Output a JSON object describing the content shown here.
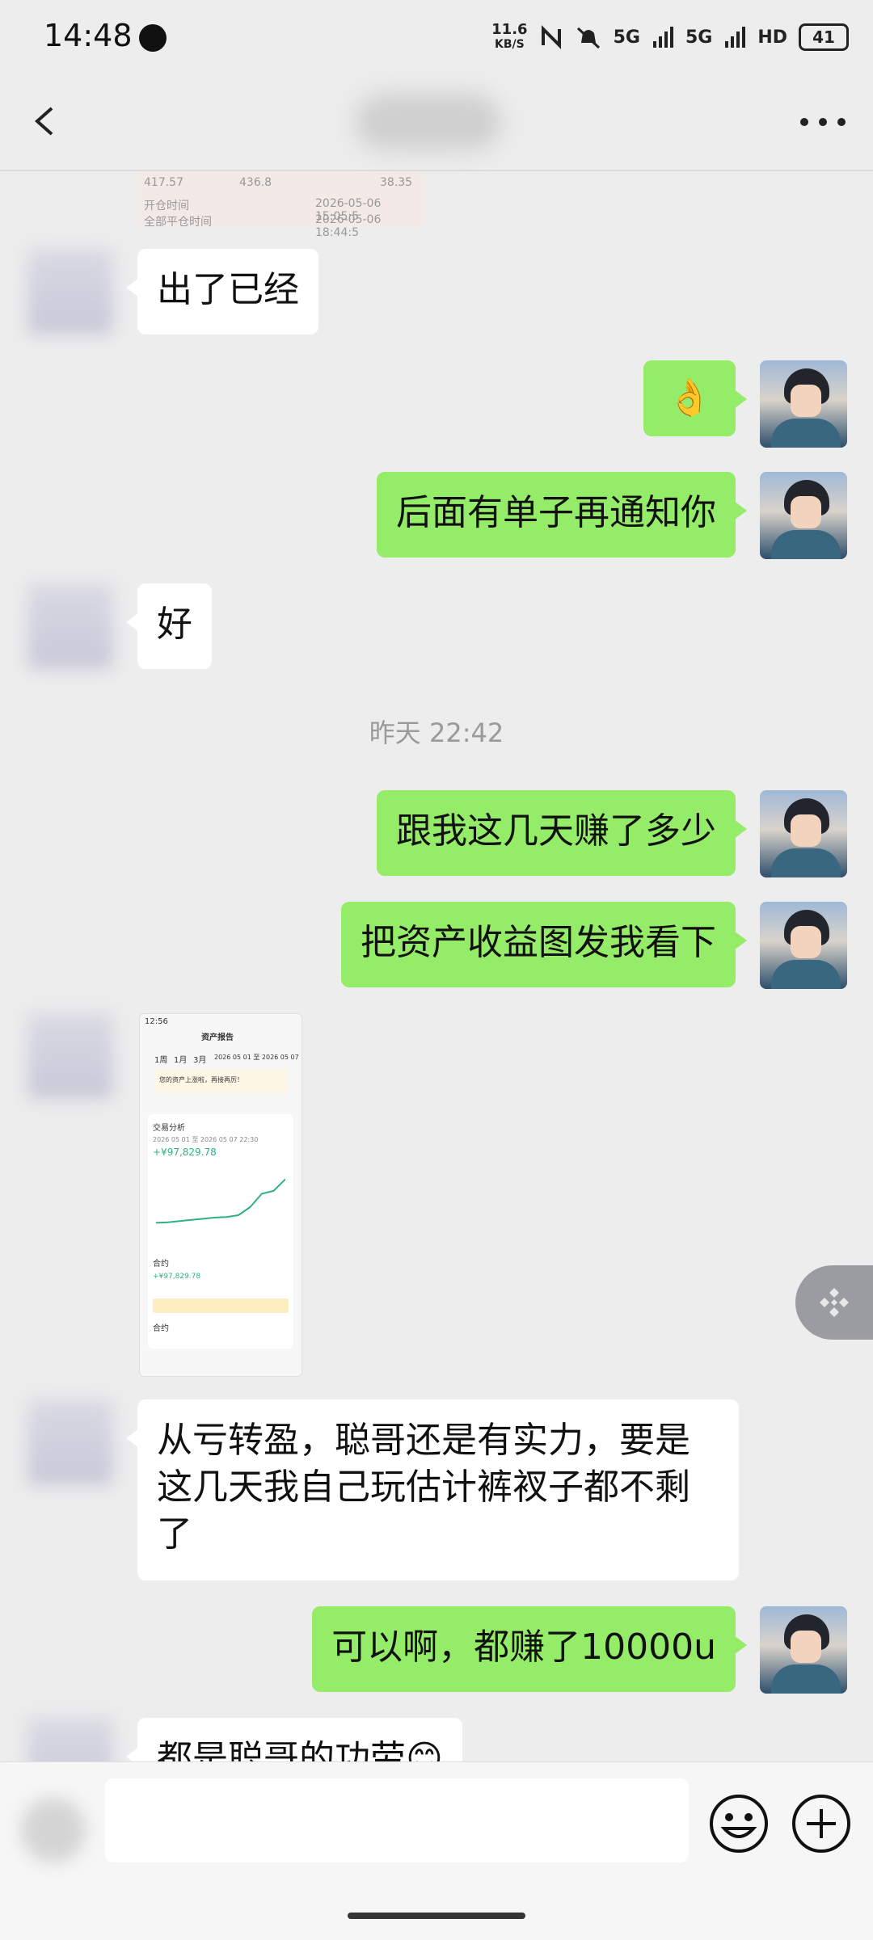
{
  "status_bar": {
    "time": "14:48",
    "net_speed_value": "11.6",
    "net_speed_unit": "KB/S",
    "signal1": "5G",
    "signal2": "5G",
    "hd_label": "HD",
    "battery": "41",
    "icons": [
      "notification-dot-icon",
      "nfc-icon",
      "mute-vibrate-icon",
      "signal-icon",
      "signal-icon",
      "battery-icon"
    ]
  },
  "top_bar": {
    "icons": [
      "back-arrow-icon",
      "more-dots-icon"
    ]
  },
  "image_preview": {
    "line1_left": "417.57",
    "line1_mid": "436.8",
    "line1_right": "38.35",
    "line2_left": "开仓时间",
    "line2_right": "2026-05-06 15:05:5",
    "line3_left": "全部平仓时间",
    "line3_right": "2026-05-06 18:44:5"
  },
  "messages": [
    {
      "side": "in",
      "text": "出了已经"
    },
    {
      "side": "out",
      "text": "👌"
    },
    {
      "side": "out",
      "text": "后面有单子再通知你"
    },
    {
      "side": "in",
      "text": "好"
    },
    {
      "side": "time",
      "text": "昨天 22:42"
    },
    {
      "side": "out",
      "text": "跟我这几天赚了多少"
    },
    {
      "side": "out",
      "text": "把资产收益图发我看下"
    },
    {
      "side": "in-image",
      "text": ""
    },
    {
      "side": "in",
      "text": "从亏转盈，聪哥还是有实力，要是这几天我自己玩估计裤衩子都不剩了"
    },
    {
      "side": "out",
      "text": "可以啊，都赚了10000u"
    },
    {
      "side": "in",
      "text": "都是聪哥的功劳😊"
    }
  ],
  "screenshot_image": {
    "status_time": "12:56",
    "title": "资产报告",
    "tabs": [
      "1周",
      "1月",
      "3月"
    ],
    "date_range": "2026 05 01 至 2026 05 07",
    "banner": "您的资产上涨啦，再接再厉！",
    "section_title": "交易分析",
    "sub_range": "2026 05 01 至 2026 05 07 22:30",
    "total_pnl": "+¥97,829.78",
    "contract_label": "合约",
    "contract_value": "+¥97,829.78",
    "bottom_label": "合约",
    "curve": [
      0.05,
      0.06,
      0.08,
      0.1,
      0.12,
      0.14,
      0.15,
      0.18,
      0.32,
      0.55,
      0.6,
      0.8
    ],
    "line_color": "#2eb082"
  }
}
